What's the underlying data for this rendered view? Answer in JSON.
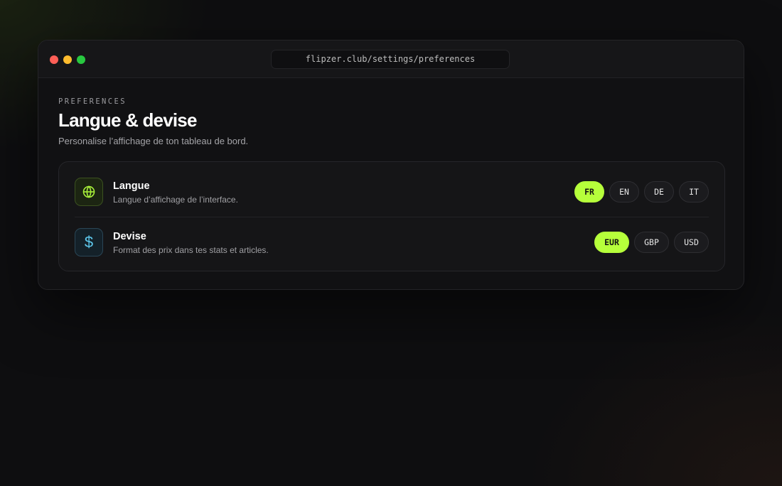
{
  "browser": {
    "url": "flipzer.club/settings/preferences"
  },
  "header": {
    "eyebrow": "PREFERENCES",
    "title": "Langue & devise",
    "subtitle": "Personalise l’affichage de ton tableau de bord."
  },
  "settings": {
    "language": {
      "icon": "globe-icon",
      "title": "Langue",
      "description": "Langue d’affichage de l’interface.",
      "options": [
        "FR",
        "EN",
        "DE",
        "IT"
      ],
      "selected": "FR"
    },
    "currency": {
      "icon": "dollar-icon",
      "icon_glyph": "$",
      "title": "Devise",
      "description": "Format des prix dans tes stats et articles.",
      "options": [
        "EUR",
        "GBP",
        "USD"
      ],
      "selected": "EUR"
    }
  },
  "colors": {
    "accent": "#b6ff3b",
    "currency_icon": "#5ec8ec",
    "background": "#0e0e10"
  }
}
